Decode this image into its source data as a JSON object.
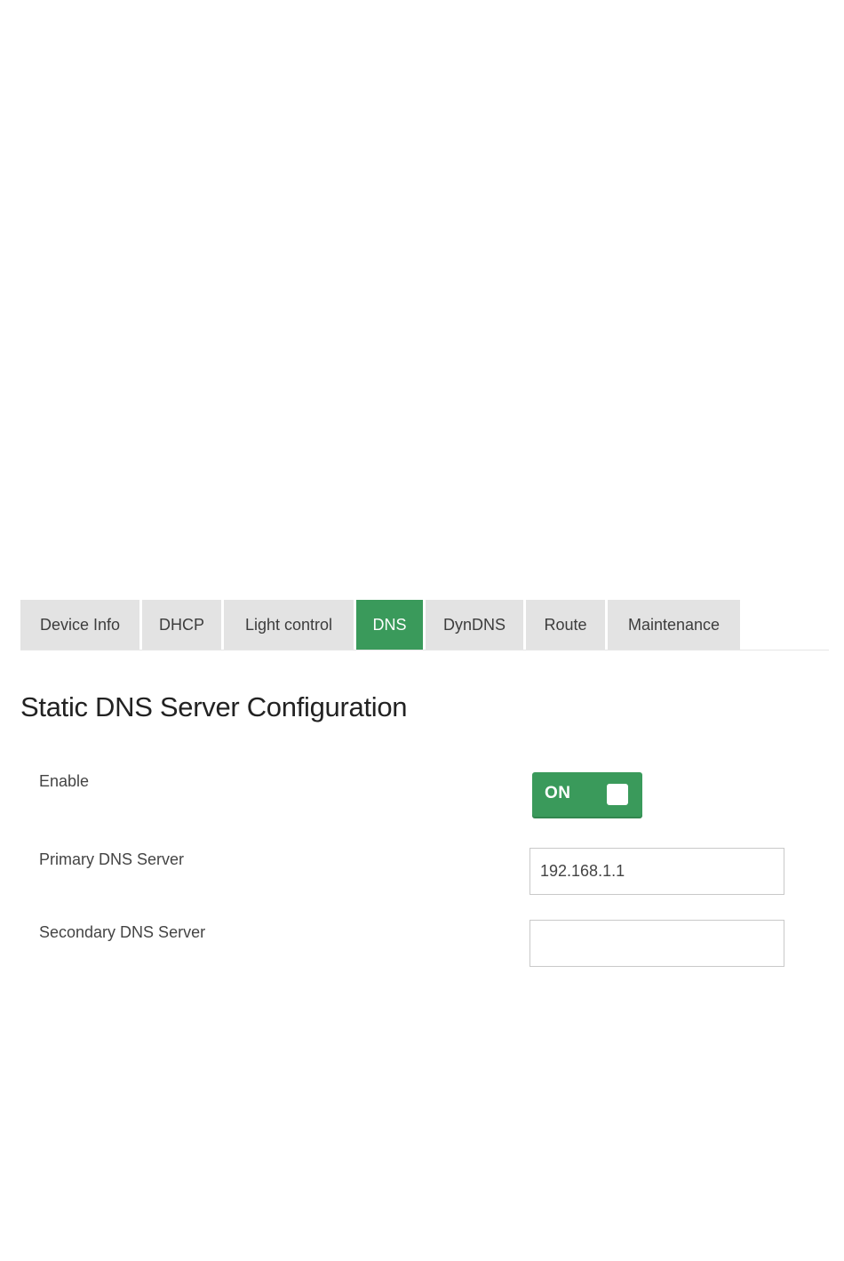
{
  "tabs": [
    {
      "label": "Device Info"
    },
    {
      "label": "DHCP"
    },
    {
      "label": "Light control"
    },
    {
      "label": "DNS",
      "active": true
    },
    {
      "label": "DynDNS"
    },
    {
      "label": "Route"
    },
    {
      "label": "Maintenance"
    }
  ],
  "page": {
    "title": "Static DNS Server Configuration"
  },
  "form": {
    "enable": {
      "label": "Enable",
      "toggle_text": "ON",
      "state": true
    },
    "primary_dns": {
      "label": "Primary DNS Server",
      "value": "192.168.1.1"
    },
    "secondary_dns": {
      "label": "Secondary DNS Server",
      "value": ""
    }
  },
  "colors": {
    "accent": "#3a9a5b",
    "tab_background": "#e3e3e3"
  }
}
